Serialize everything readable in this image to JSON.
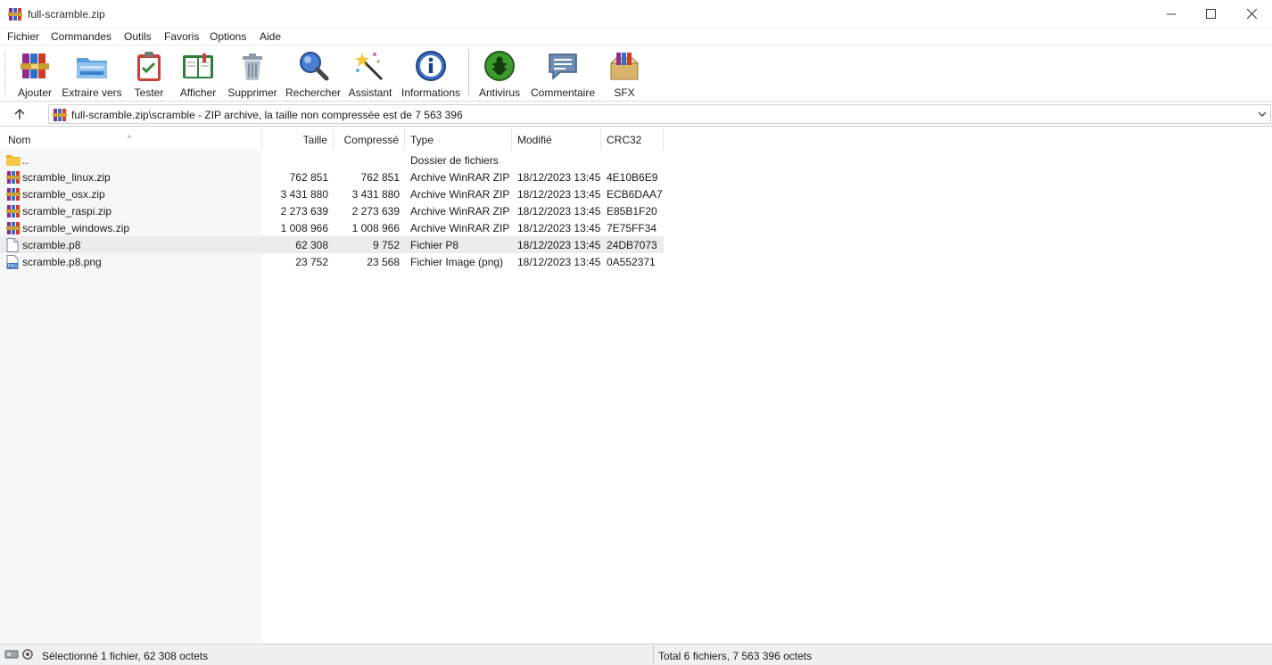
{
  "window": {
    "title": "full-scramble.zip"
  },
  "menu": [
    "Fichier",
    "Commandes",
    "Outils",
    "Favoris",
    "Options",
    "Aide"
  ],
  "toolbar": [
    {
      "label": "Ajouter",
      "icon": "add-archive-icon"
    },
    {
      "label": "Extraire vers",
      "icon": "extract-folder-icon"
    },
    {
      "label": "Tester",
      "icon": "test-clipboard-icon"
    },
    {
      "label": "Afficher",
      "icon": "view-book-icon"
    },
    {
      "label": "Supprimer",
      "icon": "trash-icon"
    },
    {
      "label": "Rechercher",
      "icon": "magnifier-icon"
    },
    {
      "label": "Assistant",
      "icon": "wizard-wand-icon"
    },
    {
      "label": "Informations",
      "icon": "info-icon"
    },
    {
      "label": "Antivirus",
      "icon": "antivirus-bug-icon"
    },
    {
      "label": "Commentaire",
      "icon": "comment-icon"
    },
    {
      "label": "SFX",
      "icon": "sfx-box-icon"
    }
  ],
  "address": {
    "path": "full-scramble.zip\\scramble - ZIP archive, la taille non compressée est de 7 563 396"
  },
  "columns": {
    "name": "Nom",
    "size": "Taille",
    "packed": "Compressé",
    "type": "Type",
    "modified": "Modifié",
    "crc": "CRC32"
  },
  "files": [
    {
      "name": "..",
      "size": "",
      "packed": "",
      "type": "Dossier de fichiers",
      "modified": "",
      "crc": "",
      "icon": "folder-icon"
    },
    {
      "name": "scramble_linux.zip",
      "size": "762 851",
      "packed": "762 851",
      "type": "Archive WinRAR ZIP",
      "modified": "18/12/2023 13:45",
      "crc": "4E10B6E9",
      "icon": "zip-archive-icon"
    },
    {
      "name": "scramble_osx.zip",
      "size": "3 431 880",
      "packed": "3 431 880",
      "type": "Archive WinRAR ZIP",
      "modified": "18/12/2023 13:45",
      "crc": "ECB6DAA7",
      "icon": "zip-archive-icon"
    },
    {
      "name": "scramble_raspi.zip",
      "size": "2 273 639",
      "packed": "2 273 639",
      "type": "Archive WinRAR ZIP",
      "modified": "18/12/2023 13:45",
      "crc": "E85B1F20",
      "icon": "zip-archive-icon"
    },
    {
      "name": "scramble_windows.zip",
      "size": "1 008 966",
      "packed": "1 008 966",
      "type": "Archive WinRAR ZIP",
      "modified": "18/12/2023 13:45",
      "crc": "7E75FF34",
      "icon": "zip-archive-icon"
    },
    {
      "name": "scramble.p8",
      "size": "62 308",
      "packed": "9 752",
      "type": "Fichier P8",
      "modified": "18/12/2023 13:45",
      "crc": "24DB7073",
      "icon": "document-icon",
      "selected": true
    },
    {
      "name": "scramble.p8.png",
      "size": "23 752",
      "packed": "23 568",
      "type": "Fichier Image (png)",
      "modified": "18/12/2023 13:45",
      "crc": "0A552371",
      "icon": "png-image-icon"
    }
  ],
  "status": {
    "left": "Sélectionné 1 fichier, 62 308 octets",
    "right": "Total 6 fichiers, 7 563 396 octets"
  }
}
